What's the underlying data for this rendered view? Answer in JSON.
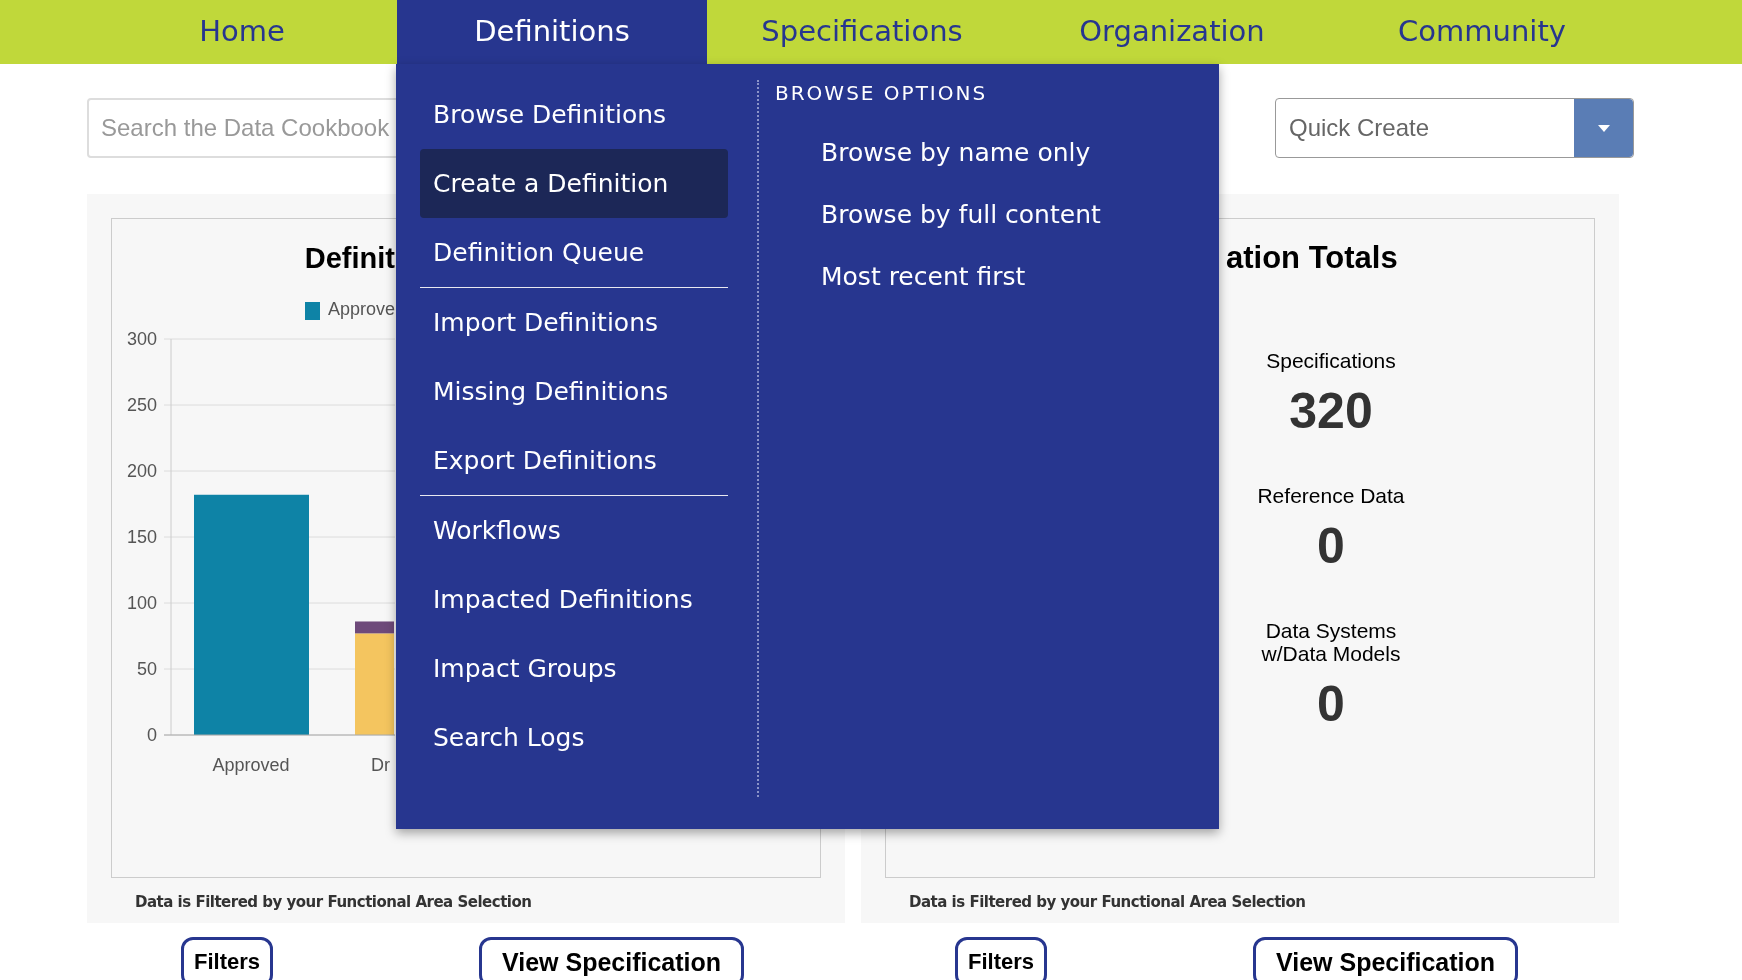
{
  "nav": [
    {
      "label": "Home",
      "selected": false
    },
    {
      "label": "Definitions",
      "selected": true
    },
    {
      "label": "Specifications",
      "selected": false
    },
    {
      "label": "Organization",
      "selected": false
    },
    {
      "label": "Community",
      "selected": false
    }
  ],
  "search": {
    "placeholder": "Search the Data Cookbook"
  },
  "quick_create": {
    "placeholder": "Quick Create"
  },
  "menu": {
    "groups": [
      [
        {
          "label": "Browse Definitions",
          "selected": false
        },
        {
          "label": "Create a Definition",
          "selected": true
        },
        {
          "label": "Definition Queue",
          "selected": false
        }
      ],
      [
        {
          "label": "Import Definitions",
          "selected": false
        },
        {
          "label": "Missing Definitions",
          "selected": false
        },
        {
          "label": "Export Definitions",
          "selected": false
        }
      ],
      [
        {
          "label": "Workflows",
          "selected": false
        },
        {
          "label": "Impacted Definitions",
          "selected": false
        },
        {
          "label": "Impact Groups",
          "selected": false
        },
        {
          "label": "Search Logs",
          "selected": false
        }
      ]
    ],
    "browse_options": {
      "heading": "BROWSE OPTIONS",
      "items": [
        "Browse by name only",
        "Browse by full content",
        "Most recent first"
      ]
    }
  },
  "panels": [
    {
      "kind": "chart",
      "title": "Definit",
      "chart_data": {
        "type": "bar",
        "stacked": true,
        "grid": true,
        "categories": [
          "Approved",
          "Dr"
        ],
        "yticks": [
          0,
          50,
          100,
          150,
          200,
          250,
          300
        ],
        "ylim": [
          0,
          300
        ],
        "series": [
          {
            "name": "Approve",
            "color": "#0e83a6",
            "values": [
              182,
              0
            ]
          },
          {
            "color": "#f4c55f",
            "values": [
              0,
              77
            ]
          },
          {
            "color": "#6e4a7a",
            "values": [
              0,
              9
            ]
          }
        ]
      },
      "footer": "Data is Filtered by your Functional Area Selection",
      "buttons": [
        "Filters",
        "View Specification"
      ]
    },
    {
      "kind": "stats",
      "title": "ation Totals",
      "stats": [
        {
          "label": "Specifications",
          "value": "320"
        },
        {
          "label": "Reference Data",
          "value": "0"
        },
        {
          "label": "Data Systems w/Data Models",
          "value": "0"
        }
      ],
      "footer": "Data is Filtered by your Functional Area Selection",
      "buttons": [
        "Filters",
        "View Specification"
      ]
    }
  ]
}
